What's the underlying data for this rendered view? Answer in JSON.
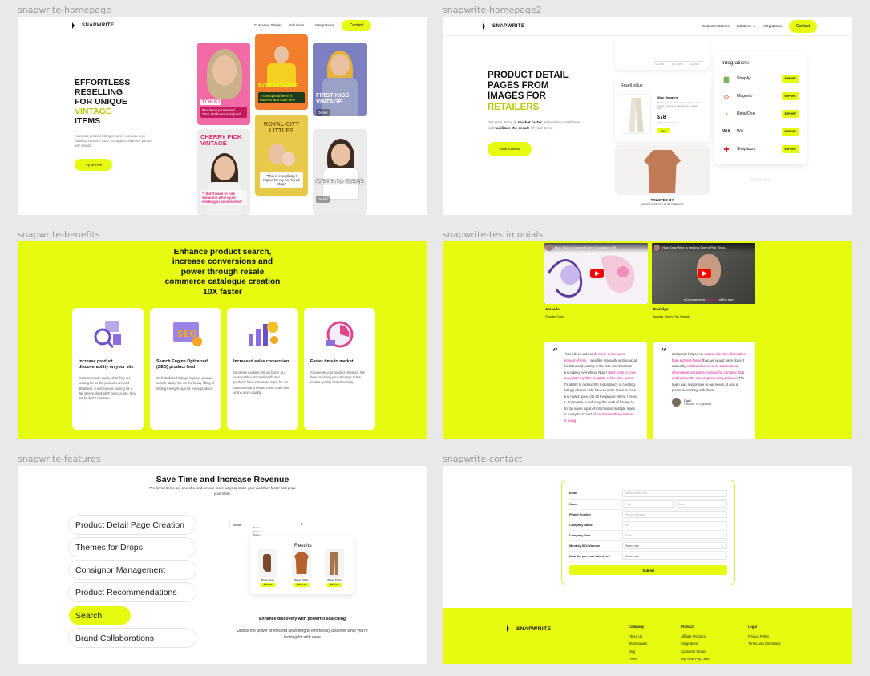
{
  "labels": {
    "home": "snapwrite-homepage",
    "home2": "snapwrite-homepage2",
    "benefits": "snapwrite-benefits",
    "testimonials": "snapwrite-testimonials",
    "features": "snapwrite-features",
    "contact": "snapwrite-contact"
  },
  "brand": "SNAPWRITE",
  "nav": {
    "customer_stories": "Customer Stories",
    "solutions": "Solutions",
    "integrations": "Integrations",
    "contact": "Contact"
  },
  "home": {
    "title_1": "EFFORTLESS",
    "title_2": "RESELLING",
    "title_3": "FOR UNIQUE",
    "title_4": "VINTAGE",
    "title_5": "ITEMS",
    "desc_1": "Automate product listing creation, increase item",
    "desc_2": "visibility, enhance SEO, manage consignors, partner",
    "desc_3": "with brands.",
    "cta": "Try for Free",
    "cards": {
      "tokki": "TOKKI",
      "tokki_stat_1": "96+ items processed",
      "tokki_stat_2": "*20K attributes assigned",
      "bon_voyage": "BON VOYAGE",
      "bon_quote": "\"I can upload items in batches and save time\"",
      "first_kiss": "FIRST KISS VINTAGE",
      "first_kiss_owner": "Owner",
      "cherry": "CHERRY PICK VINTAGE",
      "cherry_quote": "\"I don't have to hire someone who's just working in accessories\"",
      "royal": "ROYAL CITY LITTLES",
      "royal_quote": "\"This is everything I hoped for my pre-loved shop\"",
      "piece": "PIECE BY PIECE",
      "piece_owner": "Owner"
    }
  },
  "home2": {
    "title_1": "PRODUCT DETAIL",
    "title_2": "PAGES FROM",
    "title_3": "IMAGES FOR",
    "title_4": "RETAILERS",
    "desc_a": "Get your items to ",
    "desc_b": "market faster",
    "desc_c": ", streamline workflows",
    "desc_d": "and ",
    "desc_e": "facilitate the resale",
    "desc_f": " of your items",
    "cta": "Book a Demo",
    "resell_value": "Resell Value",
    "product_name": "Wide Joggers",
    "product_desc": "Elevate your comfort and style with our wide joggers - perfect for casual wear or active days.",
    "price": "$78",
    "price_note": "Suggested listing price",
    "buy": "Buy",
    "integrations_title": "Integrations",
    "integrations": [
      {
        "name": "Shopify",
        "btn": "EXPORT",
        "icon": "shopify-icon",
        "color": "#7ab55c"
      },
      {
        "name": "Magento",
        "btn": "EXPORT",
        "icon": "magento-icon",
        "color": "#ee672f"
      },
      {
        "name": "RetailOne",
        "btn": "EXPORT",
        "icon": "retailone-icon",
        "color": "#f5a623"
      },
      {
        "name": "Wix",
        "btn": "EXPORT",
        "icon": "wix-icon",
        "color": "#111111"
      },
      {
        "name": "Shoplazza",
        "btn": "EXPORT",
        "icon": "shoplazza-icon",
        "color": "#e8172a"
      }
    ],
    "attributes": "Attributes",
    "trusted_by": "TRUSTED BY",
    "trusted_sub": "brand owners and retailers",
    "chart_ticks": [
      "Sat 2023",
      "Dec 2023",
      "Jan 2024"
    ]
  },
  "benefits": {
    "title_1": "Enhance product search,",
    "title_2": "increase conversions and",
    "title_3": "power through resale",
    "title_4": "commerce catalogue creation",
    "title_5": "10X faster",
    "cards": [
      {
        "title": "Increase product discoverability on your site",
        "text": "Customers can easily what they are looking for as the products are well attributed. If someone is looking for a 'fall sleeve black shirt' on your site, they will be find it this time."
      },
      {
        "title": "Search Engine Optimized (SEO) product feed",
        "text": "Well attributed listings improve product search-ability. We do the heavy-lifting of finding the right tags for every product."
      },
      {
        "title": "Increased sales conversion",
        "text": "Generate multiple listings faster at a reasonable cost. Well-attributed products have enhanced sales for our customers and helped them scale their online store quickly."
      },
      {
        "title": "Faster time to market",
        "text": "Accelerate your product releases. We help you bring your offerings to the market quickly and effectively."
      }
    ]
  },
  "testimonials": {
    "video1_title": "How Tokki Increased Sales Stocktaking Eff...",
    "video2_title": "How SnapWrite is helping Cherry Pick Vinta...",
    "video2_caption_a": "eCommerce or ",
    "video2_caption_b": "anything",
    "video2_caption_c": " of the sort!",
    "person1": "Amanda",
    "role1": "Founder, Tokki",
    "person2": "Brooklyn",
    "role2": "Founder, Cherry Pick Vintage",
    "quote1_a": "I have been able to ",
    "quote1_b": "do more in the same amount of time",
    "quote1_c": ". I was like manually writing up all the titles and putting in the size and brackets and typing everything. Now I ",
    "quote1_d": "don't have to copy and paste my little template of like size, brand",
    "quote1_e": ". It's ability to reduce the redundancy of creating listings where I only have to enter the size once and now it goes into all the places where I need it. SnapWrite is reducing the work of having to do the same input of information multiple times in a way to, to sort of ",
    "quote1_f": "batch everything instead of doing",
    "quote2_a": "Snapwrite helped us ",
    "quote2_b": "extract relevant information from pictures faster",
    "quote2_c": " than we would have done it manually. ",
    "quote2_d": "It allowed us to semi-automate an information extraction process for complex data and reduce the cost of processing pictures",
    "quote2_e": ". The team was responsive to our needs, it was a pleasure working with them.",
    "quote2_author": "Djalil",
    "quote2_role": "Founder, of Epipresto"
  },
  "features": {
    "title": "Save Time and Increase Revenue",
    "subtitle_1": "Pre-loved items are one of a kind, create more ways to make your workflow faster and grow",
    "subtitle_2": "your store.",
    "items": [
      "Product Detail Page Creation",
      "Themes for Drops",
      "Consignor Management",
      "Product Recommendations",
      "Search",
      "Brand Collaborations"
    ],
    "search_value": "Brown",
    "results": "Results",
    "products": [
      {
        "name": "Brown Shoe",
        "color": "#7a4a2a"
      },
      {
        "name": "Brown Shirts",
        "color": "#b4622d"
      },
      {
        "name": "Brown Pants",
        "color": "#a8764a"
      }
    ],
    "add_label": "Add to cart",
    "caption_title": "Enhance discovery with powerful searching",
    "caption_1": "Unlock the power of efficient searching to effortlessly discover what you're",
    "caption_2": "looking for with ease"
  },
  "contact": {
    "fields": [
      {
        "label": "Email",
        "placeholder": "jdoe@email.com"
      },
      {
        "label": "Name",
        "placeholder": "First",
        "placeholder2": "Last"
      },
      {
        "label": "Phone Number",
        "placeholder": "Phone Number"
      },
      {
        "label": "Company Name",
        "placeholder": "Inc"
      },
      {
        "label": "Company Role",
        "placeholder": "Role"
      },
      {
        "label": "Monthly SKU Volume",
        "placeholder": "Select one..."
      },
      {
        "label": "How did you hear about us?",
        "placeholder": "Select one..."
      }
    ],
    "submit": "Submit",
    "footer": {
      "company_title": "Company",
      "company": [
        "About Us",
        "Testimonials",
        "Blog",
        "Press"
      ],
      "product_title": "Product",
      "product": [
        "Affiliate Program",
        "Integrations",
        "Customer Stories",
        "Buy Now Pay Later"
      ],
      "legal_title": "Legal",
      "legal": [
        "Privacy Policy",
        "Terms and Conditions"
      ]
    }
  },
  "colors": {
    "accent": "#e6fb0f",
    "highlight": "#e0108b",
    "green_text": "#b7c800"
  }
}
